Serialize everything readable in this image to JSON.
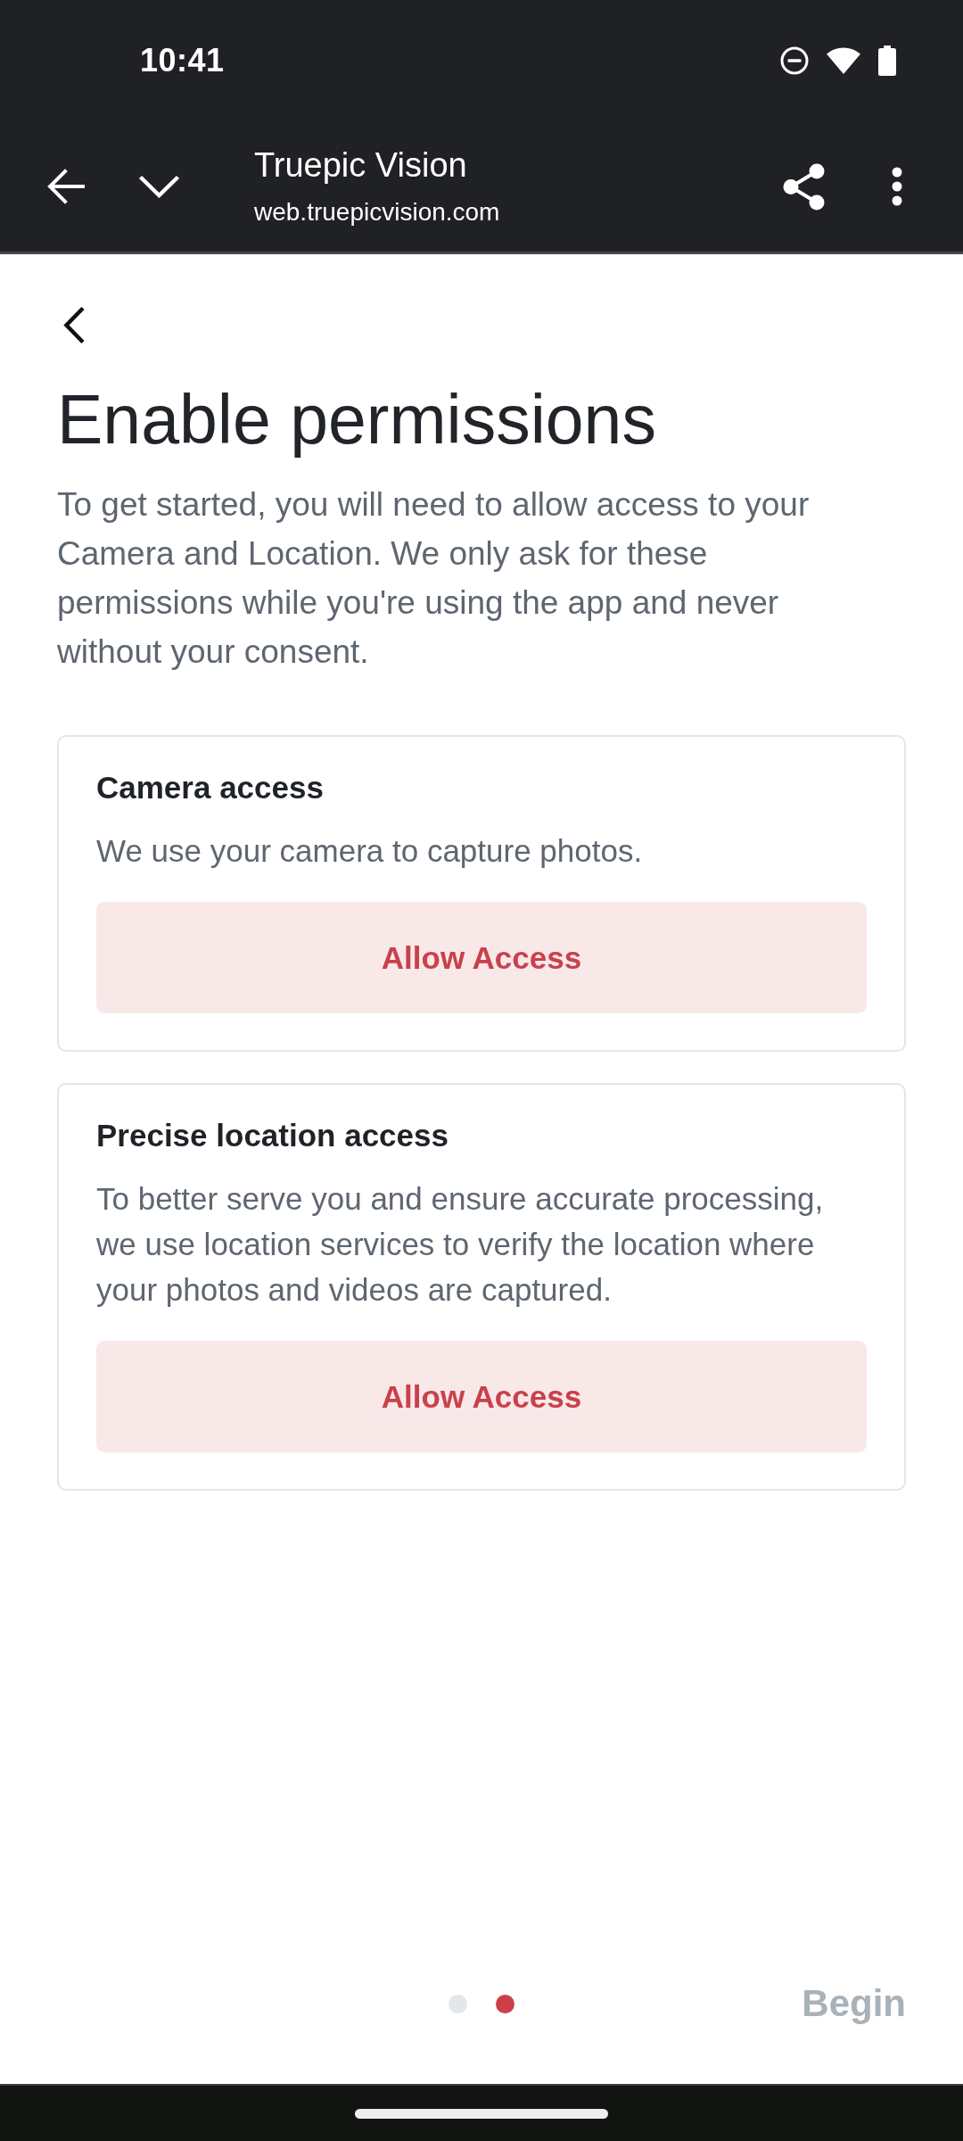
{
  "status_bar": {
    "time": "10:41"
  },
  "browser_toolbar": {
    "title": "Truepic Vision",
    "url": "web.truepicvision.com"
  },
  "page": {
    "title": "Enable permissions",
    "description": "To get started, you will need to allow access to your Camera and Location. We only ask for these permissions while you're using the app and never without your consent."
  },
  "permissions": [
    {
      "title": "Camera access",
      "description": "We use your camera to capture photos.",
      "button": "Allow Access"
    },
    {
      "title": "Precise location access",
      "description": "To better serve you and ensure accurate processing, we use location services to verify the location where your photos and videos are captured.",
      "button": "Allow Access"
    }
  ],
  "pager": {
    "dots": [
      {
        "selected": false
      },
      {
        "selected": true
      }
    ]
  },
  "begin_button": {
    "label": "Begin",
    "disabled": true
  }
}
